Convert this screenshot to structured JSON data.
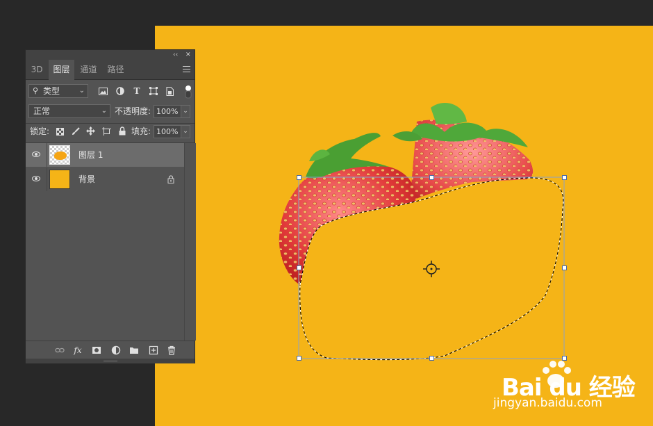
{
  "colors": {
    "canvas_bg": "#f5b417",
    "workspace_bg": "#282828",
    "panel_bg": "#535353",
    "selected_layer_bg": "#6c6c6c"
  },
  "panel": {
    "controls": {
      "collapse_icon": "double-chevron-icon",
      "close_icon": "close-icon"
    },
    "tabs": [
      {
        "label": "3D",
        "active": false
      },
      {
        "label": "图层",
        "active": true
      },
      {
        "label": "通道",
        "active": false
      },
      {
        "label": "路径",
        "active": false
      }
    ],
    "filter": {
      "kind_label": "类型",
      "icons": [
        "image-filter-icon",
        "adjustment-filter-icon",
        "type-filter-icon",
        "shape-filter-icon",
        "smart-object-filter-icon",
        "filter-toggle-icon"
      ]
    },
    "blend": {
      "mode": "正常",
      "opacity_label": "不透明度:",
      "opacity_value": "100%"
    },
    "lock": {
      "label": "锁定:",
      "icons": [
        "lock-transparent-icon",
        "lock-brush-icon",
        "lock-move-icon",
        "lock-artboard-icon",
        "lock-all-icon"
      ],
      "fill_label": "填充:",
      "fill_value": "100%"
    },
    "layers": [
      {
        "name": "图层 1",
        "visible": true,
        "selected": true,
        "locked": false
      },
      {
        "name": "背景",
        "visible": true,
        "selected": false,
        "locked": true
      }
    ],
    "footer_icons": [
      "link-icon",
      "fx-icon",
      "mask-icon",
      "adjustment-icon",
      "folder-icon",
      "new-layer-icon",
      "trash-icon"
    ],
    "footer_fx_text": "fx"
  },
  "watermark": {
    "logo_text": "Bai du 经验",
    "url": "jingyan.baidu.com"
  }
}
